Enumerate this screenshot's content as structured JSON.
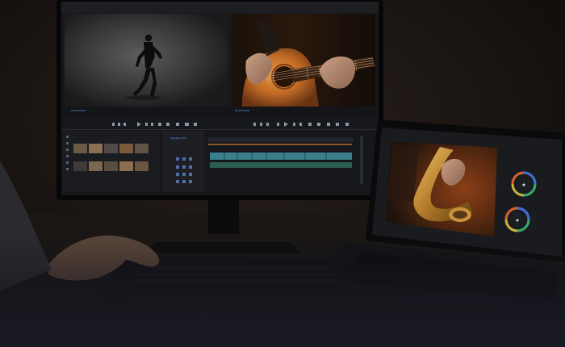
{
  "scene": {
    "subject": "desk-editing-setup"
  },
  "source_monitor": {
    "timecode": "00:00:00:00"
  },
  "program_monitor": {
    "timecode": "00:00:00:00"
  },
  "timeline": {
    "sequence_name": "Sequence 01"
  },
  "colors": {
    "backdrop": "#120f0d",
    "ui_blue": "#5aa7ff",
    "warm_light": "#c06a25",
    "track_teal": "#3b7f8c"
  }
}
